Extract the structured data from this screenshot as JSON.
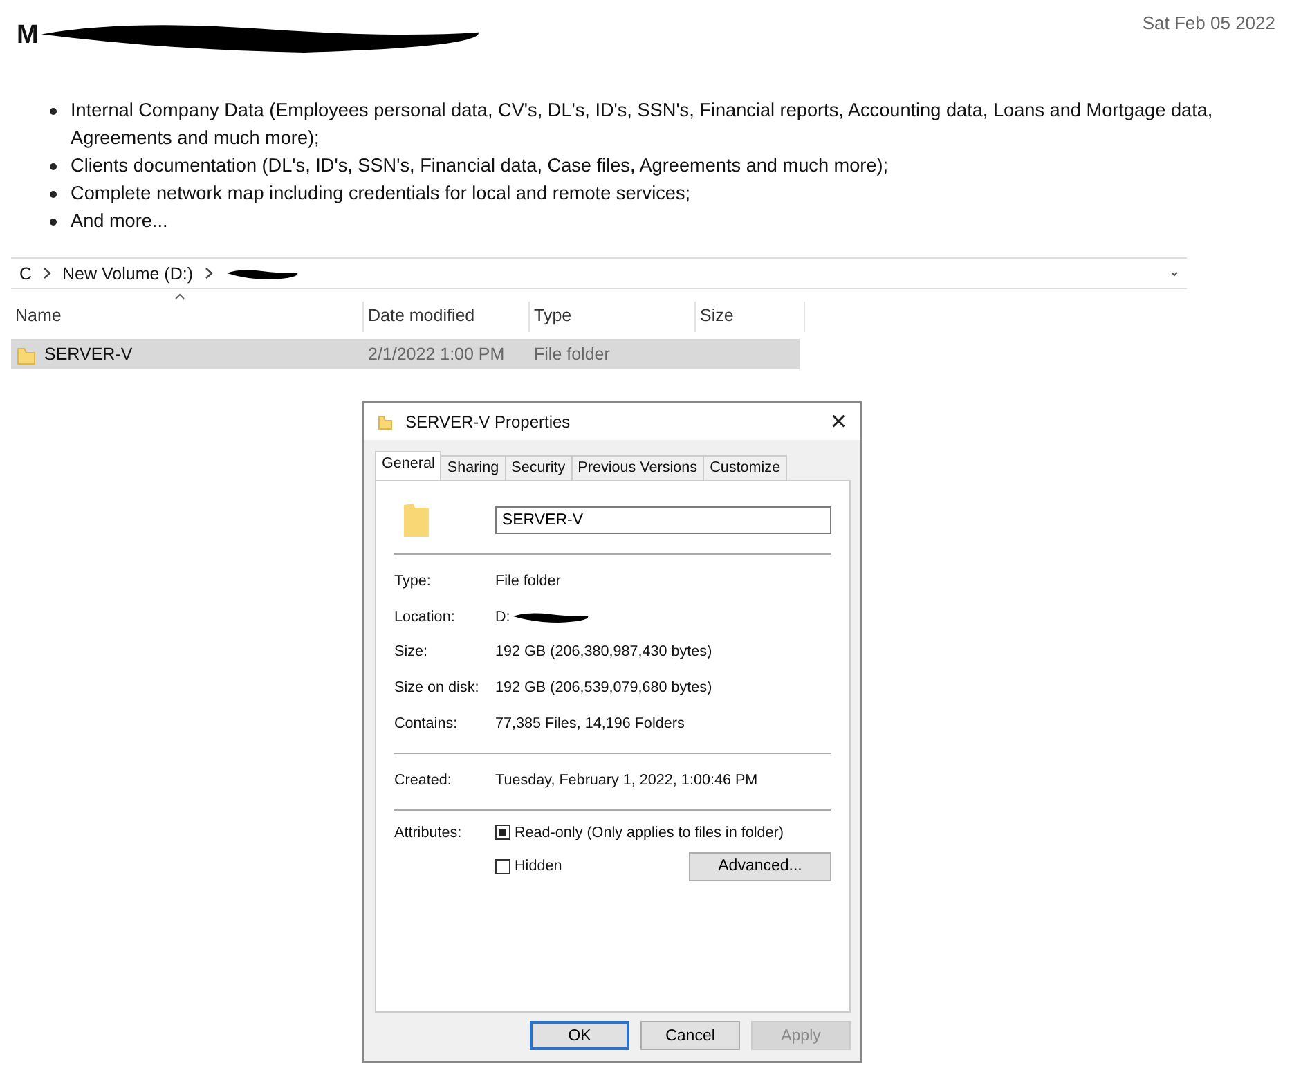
{
  "post": {
    "title": "M",
    "date": "Sat Feb 05 2022"
  },
  "bullets": [
    "Internal Company Data (Employees personal data, CV's, DL's, ID's, SSN's, Financial reports, Accounting data, Loans and Mortgage data, Agreements and much more);",
    "Clients documentation (DL's, ID's, SSN's, Financial data, Case files, Agreements and much more);",
    "Complete network map including credentials for local and remote services;",
    "And more..."
  ],
  "explorer": {
    "breadcrumb": [
      "C",
      "New Volume (D:)"
    ],
    "columns": [
      "Name",
      "Date modified",
      "Type",
      "Size"
    ],
    "rows": [
      {
        "name": "SERVER-V",
        "date": "2/1/2022 1:00 PM",
        "type": "File folder",
        "selected": true
      }
    ]
  },
  "dialog": {
    "title": "SERVER-V Properties",
    "close": "×",
    "tabs": [
      {
        "label": "General",
        "selected": true
      },
      {
        "label": "Sharing",
        "selected": false
      },
      {
        "label": "Security",
        "selected": false
      },
      {
        "label": "Previous Versions",
        "selected": false
      },
      {
        "label": "Customize",
        "selected": false
      }
    ],
    "name_value": "SERVER-V",
    "groups": [
      [
        {
          "label": "Type:",
          "value": "File folder"
        },
        {
          "label": "Location:",
          "value": "D:",
          "redacted": true
        },
        {
          "label": "Size:",
          "value": "192 GB (206,380,987,430 bytes)"
        },
        {
          "label": "Size on disk:",
          "value": "192 GB (206,539,079,680 bytes)"
        },
        {
          "label": "Contains:",
          "value": "77,385 Files, 14,196 Folders"
        }
      ],
      [
        {
          "label": "Created:",
          "value": "Tuesday, February 1, 2022, 1:00:46 PM"
        }
      ]
    ],
    "attributes_label": "Attributes:",
    "attributes": [
      {
        "label": "Read-only (Only applies to files in folder)",
        "checked": true
      },
      {
        "label": "Hidden",
        "checked": false
      }
    ],
    "advanced": "Advanced...",
    "buttons": [
      {
        "label": "OK",
        "default": true,
        "disabled": false
      },
      {
        "label": "Cancel",
        "default": false,
        "disabled": false
      },
      {
        "label": "Apply",
        "default": false,
        "disabled": true
      }
    ]
  }
}
